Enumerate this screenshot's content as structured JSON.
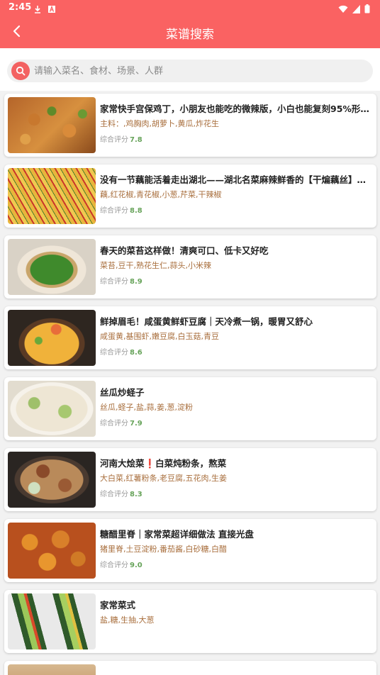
{
  "status_bar": {
    "time": "2:45"
  },
  "header": {
    "title": "菜谱搜索"
  },
  "search": {
    "placeholder": "请输入菜名、食材、场景、人群"
  },
  "score_label": "综合评分",
  "colors": {
    "header": "#fa6262",
    "score": "#67a35a",
    "ingredients": "#a86e3c"
  },
  "recipes": [
    {
      "title": "家常快手宫保鸡丁，小朋友也能吃的微辣版，小白也能复刻95%形…",
      "ingredients": "主料：,鸡胸肉,胡萝卜,黄瓜,炸花生",
      "score": "7.8"
    },
    {
      "title": "没有一节藕能活着走出湖北——湖北名菜麻辣鲜香的【干煸藕丝】【…",
      "ingredients": "藕,红花椒,青花椒,小葱,芹菜,干辣椒",
      "score": "8.8"
    },
    {
      "title": "春天的菜苔这样做！清爽可口、低卡又好吃",
      "ingredients": "菜苔,豆干,熟花生仁,蒜头,小米辣",
      "score": "8.9"
    },
    {
      "title": "鲜掉眉毛！咸蛋黄鲜虾豆腐｜天冷煮一锅，暖胃又舒心",
      "ingredients": "咸蛋黄,基围虾,嫩豆腐,白玉菇,青豆",
      "score": "8.6"
    },
    {
      "title": "丝瓜炒蛏子",
      "ingredients": "丝瓜,蛏子,盐,蒜,姜,葱,淀粉",
      "score": "7.9"
    },
    {
      "title": "河南大烩菜❗白菜炖粉条，熬菜",
      "ingredients": "大白菜,红薯粉条,老豆腐,五花肉,生姜",
      "score": "8.3"
    },
    {
      "title": "糖醋里脊｜家常菜超详细做法 直接光盘",
      "ingredients": "猪里脊,土豆淀粉,番茄酱,白砂糖,白醋",
      "score": "9.0"
    },
    {
      "title": "家常菜式",
      "ingredients": "盐,糖,生抽,大葱",
      "score": ""
    }
  ]
}
